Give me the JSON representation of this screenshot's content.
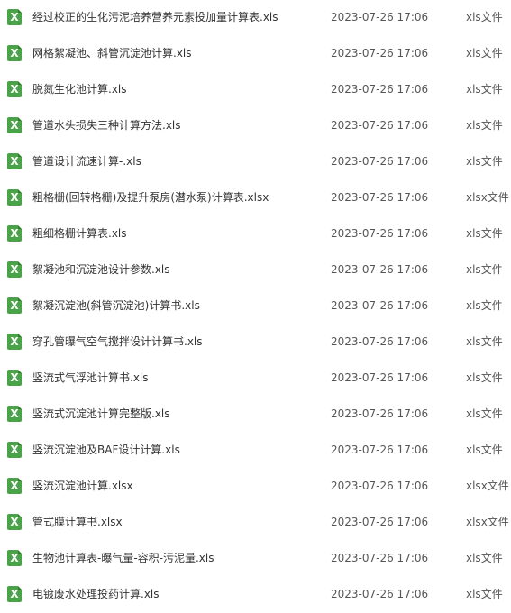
{
  "files": [
    {
      "name": "经过校正的生化污泥培养营养元素投加量计算表.xls",
      "date": "2023-07-26 17:06",
      "type": "xls文件"
    },
    {
      "name": "网格絮凝池、斜管沉淀池计算.xls",
      "date": "2023-07-26 17:06",
      "type": "xls文件"
    },
    {
      "name": "脱氮生化池计算.xls",
      "date": "2023-07-26 17:06",
      "type": "xls文件"
    },
    {
      "name": "管道水头损失三种计算方法.xls",
      "date": "2023-07-26 17:06",
      "type": "xls文件"
    },
    {
      "name": "管道设计流速计算-.xls",
      "date": "2023-07-26 17:06",
      "type": "xls文件"
    },
    {
      "name": "粗格栅(回转格栅)及提升泵房(潜水泵)计算表.xlsx",
      "date": "2023-07-26 17:06",
      "type": "xlsx文件"
    },
    {
      "name": "粗细格栅计算表.xls",
      "date": "2023-07-26 17:06",
      "type": "xls文件"
    },
    {
      "name": "絮凝池和沉淀池设计参数.xls",
      "date": "2023-07-26 17:06",
      "type": "xls文件"
    },
    {
      "name": "絮凝沉淀池(斜管沉淀池)计算书.xls",
      "date": "2023-07-26 17:06",
      "type": "xls文件"
    },
    {
      "name": "穿孔管曝气空气搅拌设计计算书.xls",
      "date": "2023-07-26 17:06",
      "type": "xls文件"
    },
    {
      "name": "竖流式气浮池计算书.xls",
      "date": "2023-07-26 17:06",
      "type": "xls文件"
    },
    {
      "name": "竖流式沉淀池计算完整版.xls",
      "date": "2023-07-26 17:06",
      "type": "xls文件"
    },
    {
      "name": "竖流沉淀池及BAF设计计算.xls",
      "date": "2023-07-26 17:06",
      "type": "xls文件"
    },
    {
      "name": "竖流沉淀池计算.xlsx",
      "date": "2023-07-26 17:06",
      "type": "xlsx文件"
    },
    {
      "name": "管式膜计算书.xlsx",
      "date": "2023-07-26 17:06",
      "type": "xlsx文件"
    },
    {
      "name": "生物池计算表-曝气量-容积-污泥量.xls",
      "date": "2023-07-26 17:06",
      "type": "xls文件"
    },
    {
      "name": "电镀废水处理投药计算.xls",
      "date": "2023-07-26 17:06",
      "type": "xls文件"
    }
  ],
  "icon": {
    "glyph": "X",
    "name": "excel-file-icon",
    "color": "#4aa348"
  }
}
